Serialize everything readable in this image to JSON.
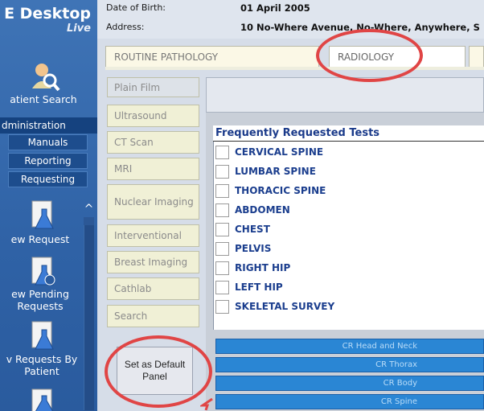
{
  "app": {
    "title_line1": "E Desktop",
    "title_line2": "Live"
  },
  "nav": {
    "patient_search": "atient Search",
    "administration": "dministration",
    "sub_items": [
      "Manuals",
      "Reporting",
      "Requesting"
    ],
    "new_request": "ew Request",
    "view_pending": [
      "ew Pending",
      "Requests"
    ],
    "requests_by_patient": [
      "v Requests By",
      "Patient"
    ]
  },
  "patient": {
    "dob_label": "Date of Birth:",
    "dob_value": "01 April 2005",
    "address_label": "Address:",
    "address_value": "10 No-Where Avenue, No-Where, Anywhere, S"
  },
  "tabs": [
    "ROUTINE PATHOLOGY",
    "RADIOLOGY"
  ],
  "modalities": [
    "Plain Film",
    "Ultrasound",
    "CT Scan",
    "MRI",
    "Nuclear Imaging",
    "Interventional",
    "Breast Imaging",
    "Cathlab",
    "Search"
  ],
  "frequent": {
    "title": "Frequently Requested Tests",
    "tests": [
      "CERVICAL SPINE",
      "LUMBAR SPINE",
      "THORACIC SPINE",
      "ABDOMEN",
      "CHEST",
      "PELVIS",
      "RIGHT HIP",
      "LEFT HIP",
      "SKELETAL SURVEY"
    ]
  },
  "categories": [
    "CR Head and Neck",
    "CR Thorax",
    "CR Body",
    "CR Spine"
  ],
  "default_button": "Set as Default Panel",
  "colors": {
    "nav_blue": "#3f74b6",
    "highlight_red": "#e04545",
    "category_blue": "#2a86d4",
    "test_blue": "#1b3e8e"
  }
}
